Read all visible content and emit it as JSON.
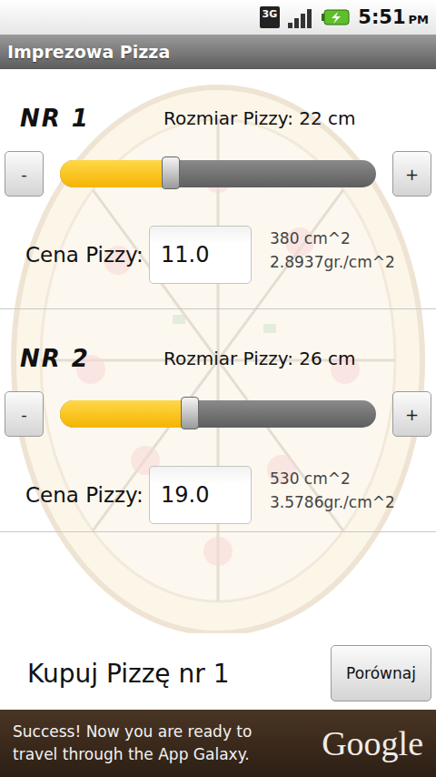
{
  "status_bar": {
    "network": "3G",
    "time": "5:51",
    "meridiem": "PM",
    "charging": true
  },
  "window": {
    "title": "Imprezowa Pizza"
  },
  "pizzas": [
    {
      "label": "NR 1",
      "size_label": "Rozmiar Pizzy: 22 cm",
      "decrement": "-",
      "increment": "+",
      "level": 0.35,
      "price_label": "Cena Pizzy:",
      "price": "11.0",
      "area": "380 cm^2",
      "unit_price": "2.8937gr./cm^2"
    },
    {
      "label": "NR 2",
      "size_label": "Rozmiar Pizzy: 26 cm",
      "decrement": "-",
      "increment": "+",
      "level": 0.41,
      "price_label": "Cena Pizzy:",
      "price": "19.0",
      "area": "530 cm^2",
      "unit_price": "3.5786gr./cm^2"
    }
  ],
  "result": "Kupuj Pizzę nr 1",
  "buttons": [
    "Porównaj"
  ],
  "ad": {
    "lines": [
      "Success! Now you are ready to",
      "travel through the App Galaxy."
    ],
    "logo": "Google"
  }
}
